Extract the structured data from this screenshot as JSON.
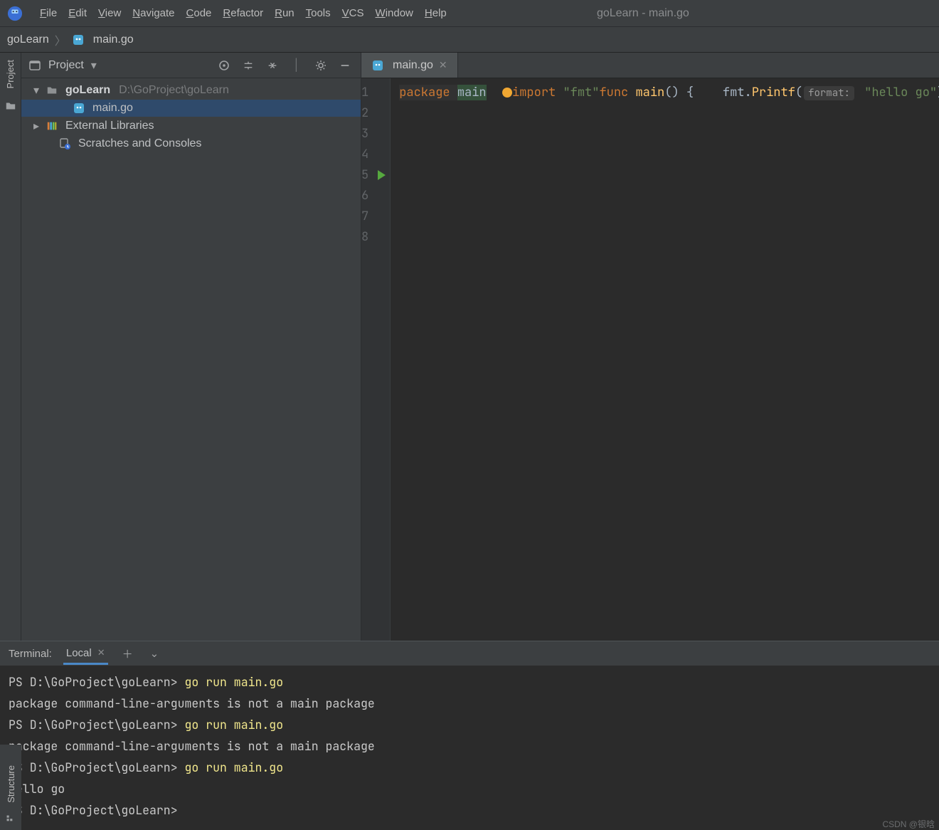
{
  "window_title": "goLearn - main.go",
  "menu": [
    "File",
    "Edit",
    "View",
    "Navigate",
    "Code",
    "Refactor",
    "Run",
    "Tools",
    "VCS",
    "Window",
    "Help"
  ],
  "breadcrumbs": {
    "root": "goLearn",
    "file": "main.go"
  },
  "left_rail": {
    "project": "Project",
    "structure": "Structure"
  },
  "project": {
    "header": "Project",
    "root_name": "goLearn",
    "root_path": "D:\\GoProject\\goLearn",
    "file": "main.go",
    "external": "External Libraries",
    "scratches": "Scratches and Consoles"
  },
  "editor_tab": {
    "label": "main.go"
  },
  "code": {
    "lines": [
      {
        "n": 1,
        "type": "bind",
        "path": "code.l1"
      },
      {
        "n": 2,
        "type": "bulb"
      },
      {
        "n": 3,
        "type": "bind",
        "path": "code.l3"
      },
      {
        "n": 4,
        "type": "empty"
      },
      {
        "n": 5,
        "type": "funcsig"
      },
      {
        "n": 6,
        "type": "printf"
      },
      {
        "n": 7,
        "type": "closebrace"
      },
      {
        "n": 8,
        "type": "empty"
      }
    ],
    "l1_pkg": "package",
    "l1_name": "main",
    "l3_import": "import",
    "l3_str": "\"fmt\"",
    "l5_func": "func",
    "l5_name": "main",
    "l5_sig_tail": "() {",
    "l6_obj": "fmt",
    "l6_fn": "Printf",
    "l6_hint": "format:",
    "l6_str": "\"hello go\"",
    "l7_close": "}"
  },
  "terminal": {
    "title": "Terminal:",
    "tab": "Local",
    "lines": [
      {
        "prefix": "PS D:\\GoProject\\goLearn> ",
        "cmd": "go run main.go"
      },
      {
        "text": "package command-line-arguments is not a main package"
      },
      {
        "prefix": "PS D:\\GoProject\\goLearn> ",
        "cmd": "go run main.go"
      },
      {
        "text": "package command-line-arguments is not a main package"
      },
      {
        "prefix": "PS D:\\GoProject\\goLearn> ",
        "cmd": "go run main.go"
      },
      {
        "text": "hello go"
      },
      {
        "prefix": "PS D:\\GoProject\\goLearn>",
        "cmd": ""
      }
    ]
  },
  "watermark": "CSDN @银晗"
}
